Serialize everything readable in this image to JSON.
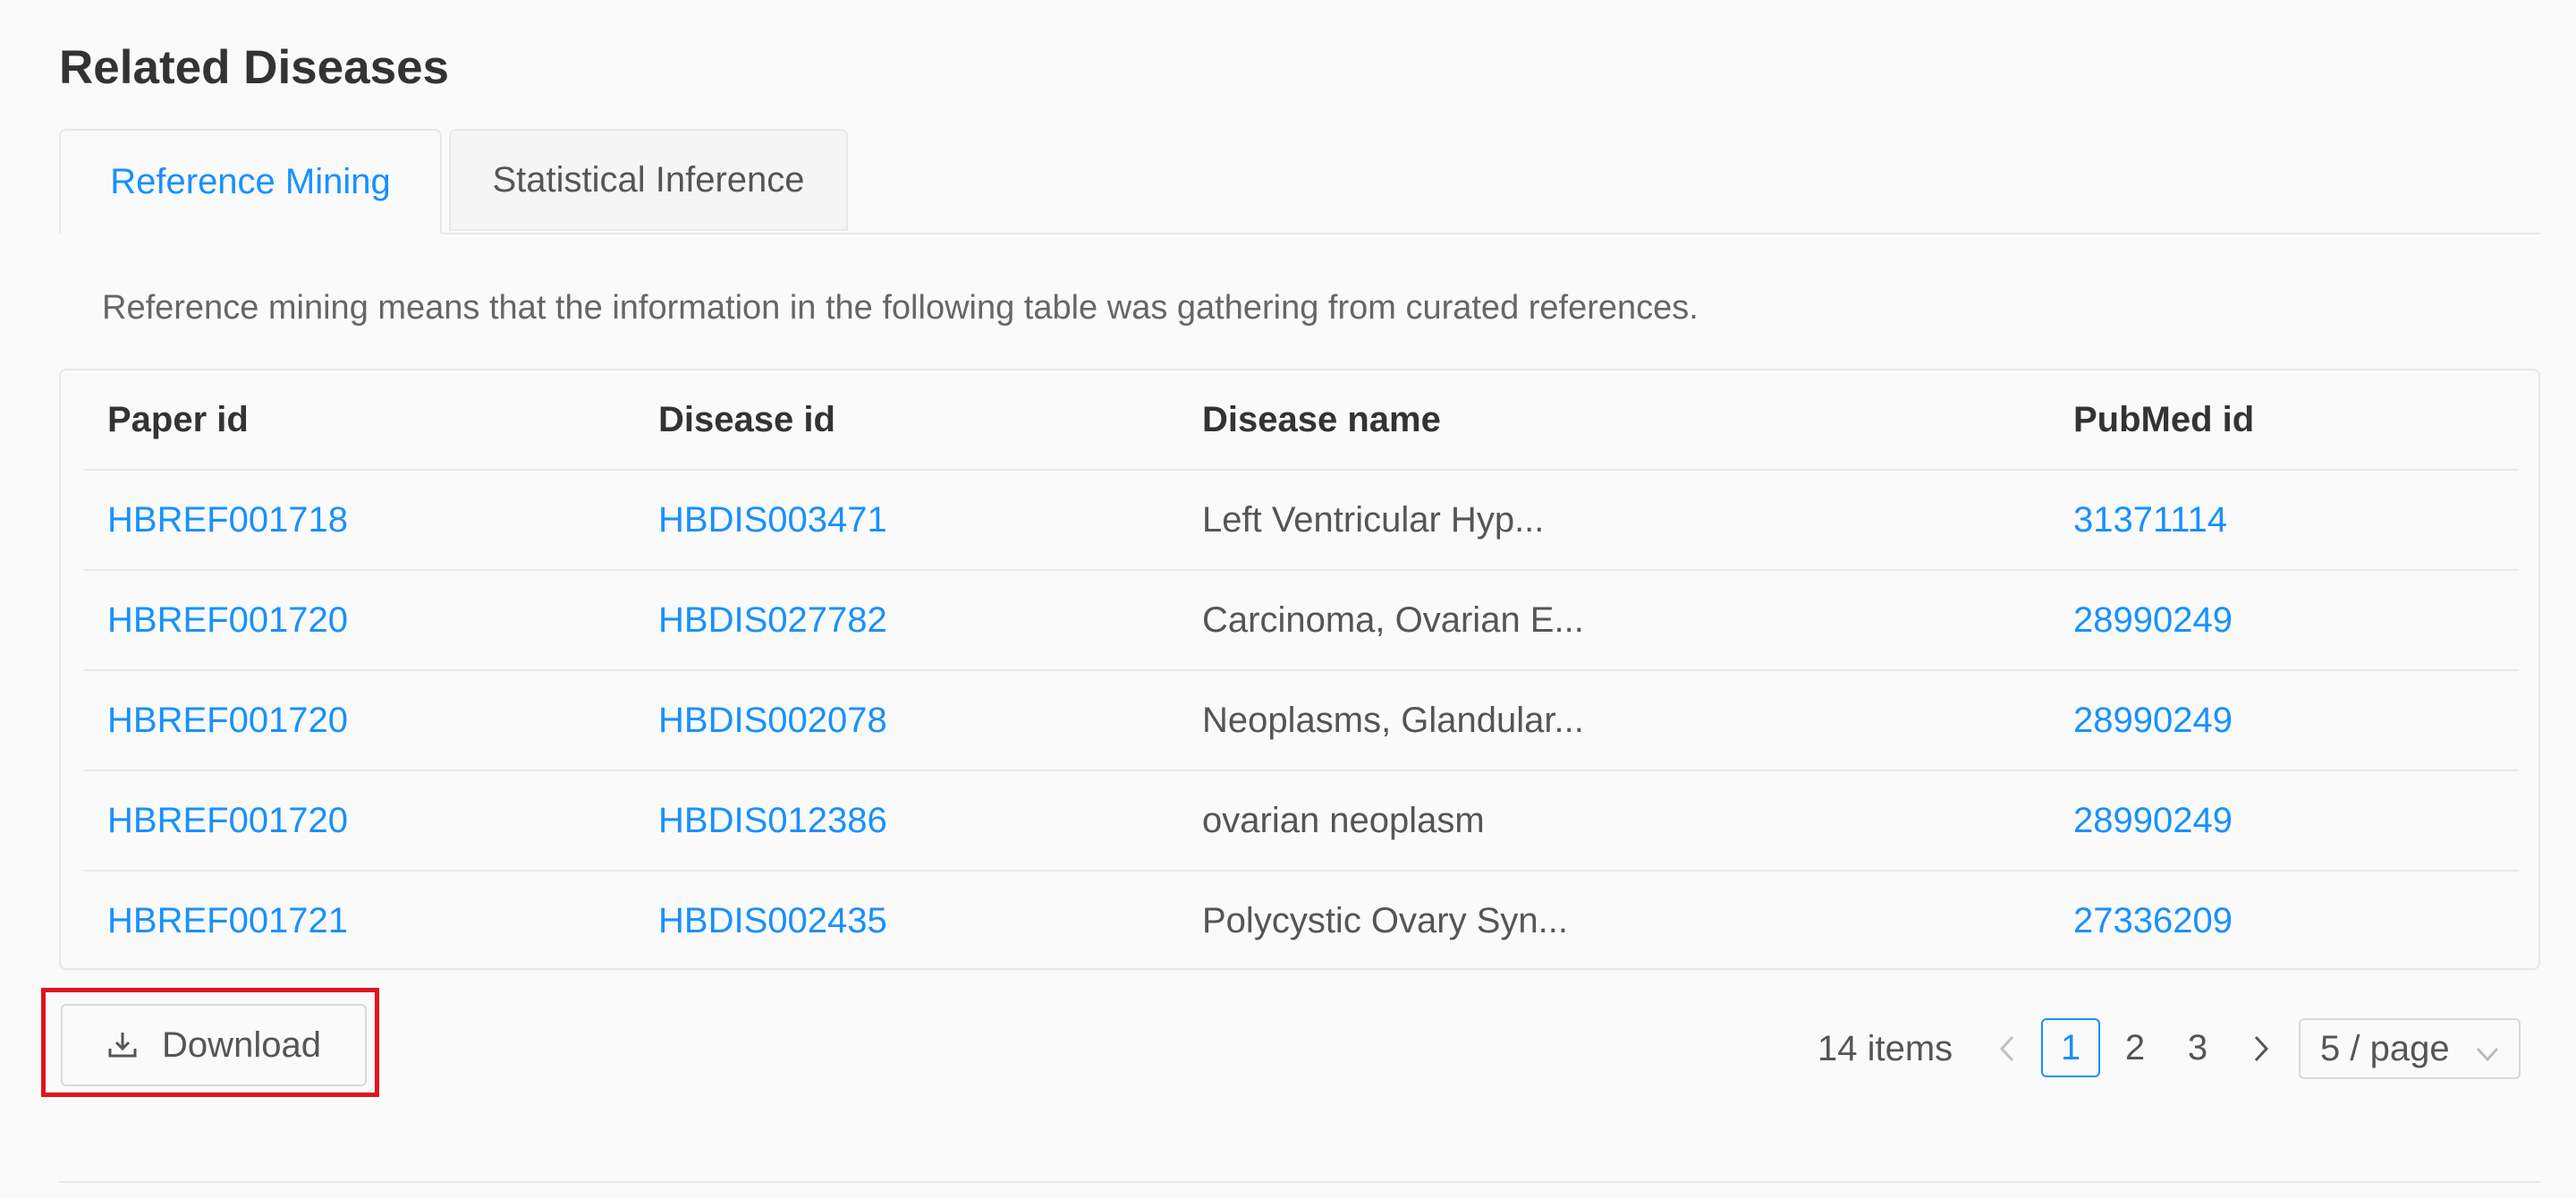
{
  "section": {
    "title": "Related Diseases"
  },
  "tabs": [
    {
      "label": "Reference Mining",
      "active": true
    },
    {
      "label": "Statistical Inference",
      "active": false
    }
  ],
  "description": "Reference mining means that the information in the following table was gathering from curated references.",
  "table": {
    "columns": [
      "Paper id",
      "Disease id",
      "Disease name",
      "PubMed id"
    ],
    "rows": [
      {
        "paper_id": "HBREF001718",
        "disease_id": "HBDIS003471",
        "disease_name": "Left Ventricular Hyp...",
        "pubmed_id": "31371114"
      },
      {
        "paper_id": "HBREF001720",
        "disease_id": "HBDIS027782",
        "disease_name": "Carcinoma, Ovarian E...",
        "pubmed_id": "28990249"
      },
      {
        "paper_id": "HBREF001720",
        "disease_id": "HBDIS002078",
        "disease_name": "Neoplasms, Glandular...",
        "pubmed_id": "28990249"
      },
      {
        "paper_id": "HBREF001720",
        "disease_id": "HBDIS012386",
        "disease_name": "ovarian neoplasm",
        "pubmed_id": "28990249"
      },
      {
        "paper_id": "HBREF001721",
        "disease_id": "HBDIS002435",
        "disease_name": "Polycystic Ovary Syn...",
        "pubmed_id": "27336209"
      }
    ]
  },
  "download": {
    "label": "Download",
    "icon": "download-icon"
  },
  "pagination": {
    "total": "14 items",
    "pages": [
      "1",
      "2",
      "3"
    ],
    "current": "1",
    "page_size": "5 / page",
    "prev_icon": "chevron-left-icon",
    "next_icon": "chevron-right-icon"
  },
  "colors": {
    "accent": "#1890ff",
    "highlight": "#e0141e",
    "border": "#e8e8e8"
  }
}
